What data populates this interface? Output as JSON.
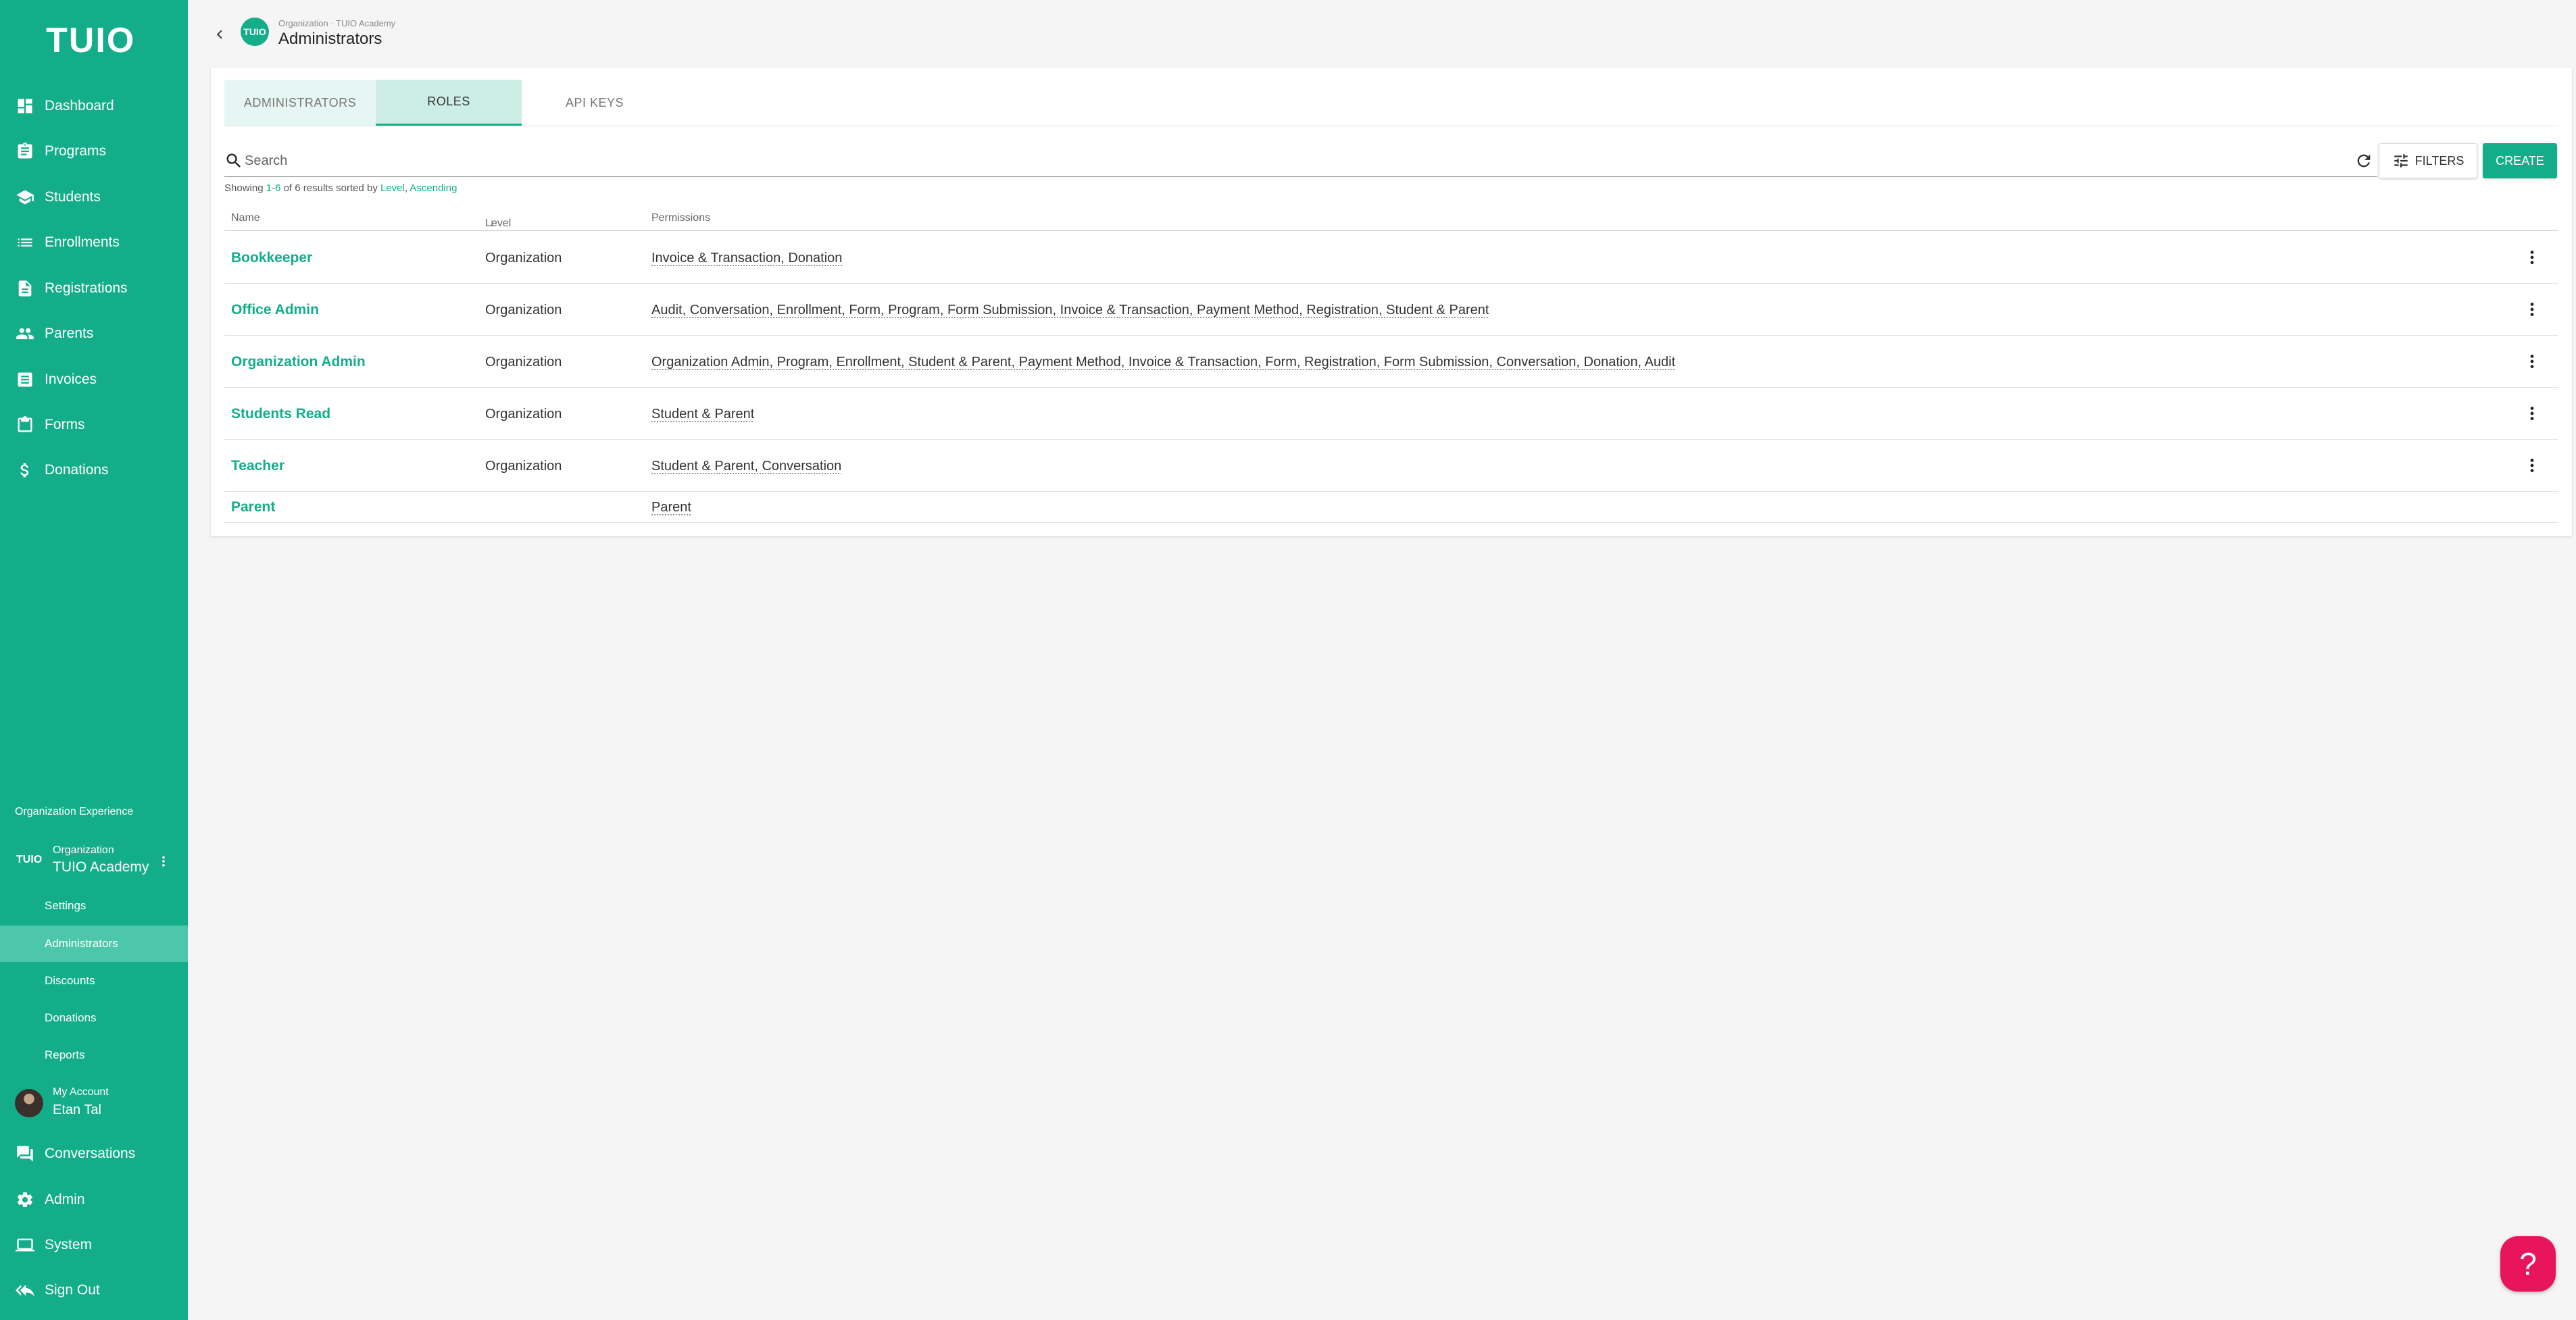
{
  "sidebar": {
    "logo": "TUIO",
    "nav": [
      {
        "label": "Dashboard",
        "icon": "dashboard-icon"
      },
      {
        "label": "Programs",
        "icon": "clipboard-icon"
      },
      {
        "label": "Students",
        "icon": "school-icon"
      },
      {
        "label": "Enrollments",
        "icon": "list-icon"
      },
      {
        "label": "Registrations",
        "icon": "document-icon"
      },
      {
        "label": "Parents",
        "icon": "people-icon"
      },
      {
        "label": "Invoices",
        "icon": "invoice-icon"
      },
      {
        "label": "Forms",
        "icon": "form-icon"
      },
      {
        "label": "Donations",
        "icon": "dollar-icon"
      }
    ],
    "org_experience": "Organization Experience",
    "org": {
      "logo": "TUIO",
      "type": "Organization",
      "name": "TUIO Academy"
    },
    "org_sub": [
      {
        "label": "Settings"
      },
      {
        "label": "Administrators",
        "active": true
      },
      {
        "label": "Discounts"
      },
      {
        "label": "Donations"
      },
      {
        "label": "Reports"
      }
    ],
    "account": {
      "label": "My Account",
      "name": "Etan Tal"
    },
    "bottom_nav": [
      {
        "label": "Conversations",
        "icon": "chat-icon"
      },
      {
        "label": "Admin",
        "icon": "gear-icon"
      },
      {
        "label": "System",
        "icon": "monitor-icon"
      },
      {
        "label": "Sign Out",
        "icon": "sign-out-icon"
      }
    ]
  },
  "header": {
    "logo": "TUIO",
    "breadcrumb": "Organization · TUIO Academy",
    "title": "Administrators"
  },
  "tabs": [
    {
      "label": "ADMINISTRATORS"
    },
    {
      "label": "ROLES",
      "active": true
    },
    {
      "label": "API KEYS"
    }
  ],
  "search": {
    "placeholder": "Search",
    "value": ""
  },
  "toolbar": {
    "filters_label": "FILTERS",
    "create_label": "CREATE"
  },
  "results": {
    "prefix": "Showing ",
    "range": "1-6",
    "of": " of ",
    "total": "6",
    "mid": " results sorted by ",
    "sort_field": "Level",
    "sep": ", ",
    "sort_dir": "Ascending"
  },
  "table": {
    "columns": [
      "Name",
      "Level",
      "Permissions"
    ],
    "sort_indicator": "↓",
    "rows": [
      {
        "name": "Bookkeeper",
        "level": "Organization",
        "permissions": "Invoice & Transaction, Donation",
        "has_menu": true
      },
      {
        "name": "Office Admin",
        "level": "Organization",
        "permissions": "Audit, Conversation, Enrollment, Form, Program, Form Submission, Invoice & Transaction, Payment Method, Registration, Student & Parent",
        "has_menu": true
      },
      {
        "name": "Organization Admin",
        "level": "Organization",
        "permissions": "Organization Admin, Program, Enrollment, Student & Parent, Payment Method, Invoice & Transaction, Form, Registration, Form Submission, Conversation, Donation, Audit",
        "has_menu": true
      },
      {
        "name": "Students Read",
        "level": "Organization",
        "permissions": "Student & Parent",
        "has_menu": true
      },
      {
        "name": "Teacher",
        "level": "Organization",
        "permissions": "Student & Parent, Conversation",
        "has_menu": true
      },
      {
        "name": "Parent",
        "level": "",
        "permissions": "Parent",
        "has_menu": false
      }
    ]
  },
  "help": {
    "label": "?"
  }
}
